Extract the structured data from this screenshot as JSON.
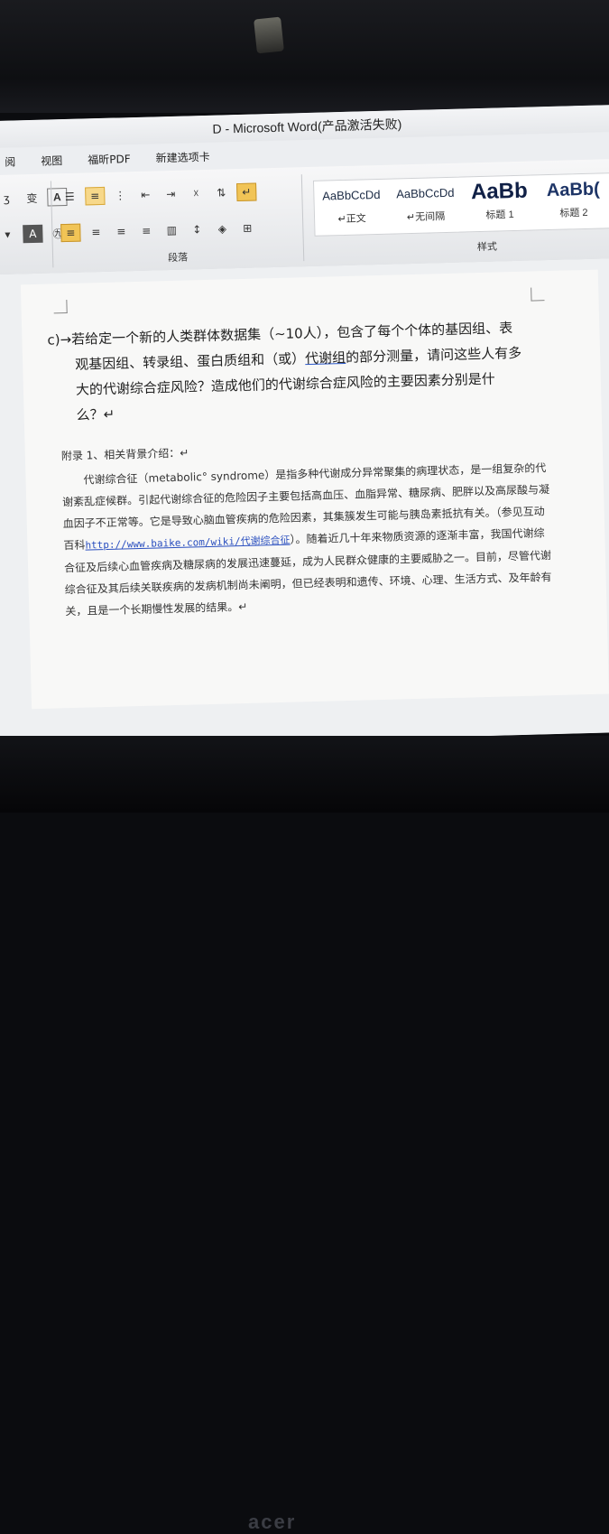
{
  "window": {
    "title": "D - Microsoft Word(产品激活失败)"
  },
  "tabs": [
    "阅",
    "视图",
    "福昕PDF",
    "新建选项卡"
  ],
  "ribbon": {
    "paragraph_group_label": "段落",
    "styles_group_label": "样式",
    "styles": [
      {
        "preview": "AaBbCcDd",
        "name": "↵正文"
      },
      {
        "preview": "AaBbCcDd",
        "name": "↵无间隔"
      },
      {
        "preview": "AaBb",
        "name": "标题 1"
      },
      {
        "preview": "AaBb(",
        "name": "标题 2"
      }
    ]
  },
  "document": {
    "question_prefix": "c)→",
    "question_lines": [
      "若给定一个新的人类群体数据集（~10人），包含了每个个体的基因组、表",
      "观基因组、转录组、蛋白质组和（或）",
      "代谢组",
      "的部分测量，请问这些人有多",
      "大的代谢综合症风险？造成他们的代谢综合症风险的主要因素分别是什",
      "么？↵"
    ],
    "appendix_title": "附录 1、相关背景介绍：↵",
    "appendix_text_1": "代谢综合征（metabolic° syndrome）是指多种代谢成分异常聚集的病理状态，是一组复杂的代谢紊乱症候群。引起代谢综合征的危险因子主要包括高血压、血脂异常、糖尿病、肥胖以及高尿酸与凝血因子不正常等。它是导致心脑血管疾病的危险因素，其集簇发生可能与胰岛素抵抗有关。（参见互动百科",
    "appendix_link": "http://www.baike.com/wiki/代谢综合征",
    "appendix_text_2": "）。随着近几十年来物质资源的逐渐丰富，我国代谢综合征及后续心血管疾病及糖尿病的发展迅速蔓延，成为人民群众健康的主要威胁之一。目前，尽管代谢综合征及其后续关联疾病的发病机制尚未阐明，但已经表明和遗传、环境、心理、生活方式、及年龄有关，且是一个长期慢性发展的结果。↵"
  },
  "device": {
    "brand": "acer"
  }
}
